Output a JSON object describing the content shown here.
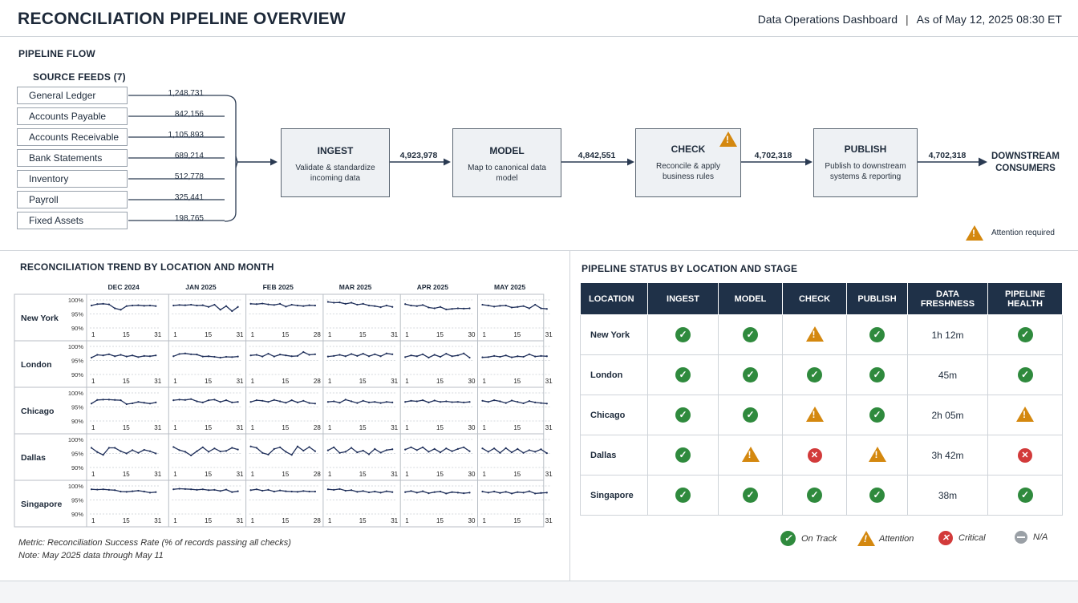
{
  "header": {
    "title": "RECONCILIATION PIPELINE OVERVIEW",
    "dashboard": "Data Operations Dashboard",
    "separator": "|",
    "as_of": "As of May 12, 2025 08:30 ET"
  },
  "flow": {
    "section_title": "PIPELINE FLOW",
    "feeds_title": "SOURCE FEEDS (7)",
    "feeds": [
      {
        "name": "General Ledger",
        "value": "1,248,731"
      },
      {
        "name": "Accounts Payable",
        "value": "842,156"
      },
      {
        "name": "Accounts Receivable",
        "value": "1,105,893"
      },
      {
        "name": "Bank Statements",
        "value": "689,214"
      },
      {
        "name": "Inventory",
        "value": "512,778"
      },
      {
        "name": "Payroll",
        "value": "325,441"
      },
      {
        "name": "Fixed Assets",
        "value": "198,765"
      }
    ],
    "stages": [
      {
        "title": "INGEST",
        "desc1": "Validate & standardize",
        "desc2": "incoming data"
      },
      {
        "title": "MODEL",
        "desc1": "Map to canonical data",
        "desc2": "model"
      },
      {
        "title": "CHECK",
        "desc1": "Reconcile & apply",
        "desc2": "business rules"
      },
      {
        "title": "PUBLISH",
        "desc1": "Publish to downstream",
        "desc2": "systems & reporting"
      }
    ],
    "flow_values": [
      "4,923,978",
      "4,842,551",
      "4,702,318",
      "4,702,318"
    ],
    "downstream1": "DOWNSTREAM",
    "downstream2": "CONSUMERS",
    "attention_label": "Attention required"
  },
  "trend": {
    "section_title": "RECONCILIATION TREND BY LOCATION AND MONTH",
    "months": [
      "DEC 2024",
      "JAN 2025",
      "FEB 2025",
      "MAR 2025",
      "APR 2025",
      "MAY 2025"
    ],
    "month_end": [
      "31",
      "31",
      "28",
      "31",
      "30",
      "31"
    ],
    "locations": [
      "New York",
      "London",
      "Chicago",
      "Dallas",
      "Singapore"
    ],
    "y_ticks": [
      "100%",
      "95%",
      "90%"
    ],
    "x_start": "1",
    "x_mid": "15",
    "note1": "Metric: Reconciliation Success Rate (% of records passing all checks)",
    "note2": "Note: May 2025 data through May 11"
  },
  "chart_data": {
    "type": "line",
    "title": "RECONCILIATION TREND BY LOCATION AND MONTH",
    "ylim": [
      89,
      100
    ],
    "series": [
      {
        "name": "New York",
        "months": [
          [
            98,
            98.5,
            98.6,
            98.4,
            97,
            96.5,
            97.8,
            98,
            98.1,
            97.9,
            98,
            97.8
          ],
          [
            98,
            98.2,
            98.1,
            98.3,
            98,
            98.1,
            97.5,
            98.3,
            96.5,
            97.8,
            96,
            97.5
          ],
          [
            98.6,
            98.5,
            98.7,
            98.4,
            98.2,
            98.6,
            97.6,
            98.3,
            98,
            97.8,
            98.1,
            98
          ],
          [
            99.3,
            99,
            99.1,
            98.6,
            99,
            98.3,
            98.6,
            98,
            97.8,
            97.4,
            98,
            97.5
          ],
          [
            98.5,
            98,
            97.8,
            98.2,
            97.3,
            97,
            97.5,
            96.6,
            96.8,
            97,
            96.9,
            97
          ],
          [
            98.3,
            98,
            97.6,
            97.9,
            98,
            97.3,
            97.5,
            97.8,
            97,
            98.3,
            97,
            96.8
          ]
        ]
      },
      {
        "name": "London",
        "months": [
          [
            96,
            97,
            96.8,
            97.2,
            96.5,
            97,
            96.4,
            96.8,
            96.2,
            96.6,
            96.5,
            96.8
          ],
          [
            96.5,
            97.3,
            97.5,
            97.2,
            97.1,
            96.4,
            96.5,
            96.3,
            96,
            96.3,
            96.2,
            96.4
          ],
          [
            96.8,
            97,
            96.4,
            97.4,
            96.4,
            97.1,
            96.8,
            96.5,
            96.6,
            98,
            97,
            97.2
          ],
          [
            96.4,
            96.6,
            97,
            96.5,
            97.3,
            96.6,
            97.4,
            96.5,
            97.2,
            96.5,
            97.5,
            97.2
          ],
          [
            96.2,
            96.8,
            96.5,
            97.2,
            96,
            97,
            96.3,
            97.4,
            96.5,
            96.8,
            97.5,
            96
          ],
          [
            96.1,
            96.2,
            96.6,
            96.3,
            96.8,
            96.1,
            96.5,
            96.3,
            97.2,
            96.4,
            96.6,
            96.5
          ]
        ]
      },
      {
        "name": "Chicago",
        "months": [
          [
            96.2,
            97.5,
            97.6,
            97.6,
            97.5,
            97.4,
            96,
            96.3,
            96.8,
            96.5,
            96.2,
            96.6
          ],
          [
            97.4,
            97.6,
            97.5,
            97.8,
            97,
            96.6,
            97.4,
            97.6,
            96.8,
            97.4,
            96.6,
            96.8
          ],
          [
            96.8,
            97.4,
            97.2,
            96.8,
            97.5,
            97,
            96.5,
            97.4,
            96.6,
            97.2,
            96.4,
            96.2
          ],
          [
            96.8,
            97,
            96.5,
            97.6,
            97,
            96.4,
            97.2,
            96.6,
            96.8,
            96.4,
            96.8,
            96.6
          ],
          [
            96.8,
            97.2,
            97,
            97.4,
            96.6,
            97.3,
            96.8,
            97,
            96.7,
            96.8,
            96.6,
            96.8
          ],
          [
            97.2,
            96.8,
            97.4,
            97,
            96.4,
            97.3,
            96.8,
            96.3,
            97.1,
            96.6,
            96.4,
            96.2
          ]
        ]
      },
      {
        "name": "Dallas",
        "months": [
          [
            97,
            95.5,
            94.5,
            97,
            97,
            95.8,
            95,
            96.2,
            95.2,
            96.3,
            95.8,
            95
          ],
          [
            97.3,
            96.2,
            95.6,
            94.3,
            95.8,
            97.2,
            95.6,
            96.8,
            95.7,
            95.9,
            97,
            96.4
          ],
          [
            97.5,
            97,
            95.2,
            94.6,
            96.6,
            97.2,
            95.6,
            94.5,
            97.5,
            96,
            97.3,
            95.8
          ],
          [
            96.1,
            97.2,
            95.2,
            95.6,
            97,
            95.4,
            96,
            94.7,
            96.6,
            95.3,
            96.2,
            96.5
          ],
          [
            96.4,
            97.2,
            96.2,
            97.2,
            95.6,
            96.6,
            95.4,
            96.8,
            95.8,
            96.6,
            97.2,
            95.8
          ],
          [
            96.8,
            95.6,
            96.8,
            95.2,
            96.9,
            95.4,
            96.6,
            95.2,
            96.2,
            95.6,
            96.5,
            95.1
          ]
        ]
      },
      {
        "name": "Singapore",
        "months": [
          [
            98.8,
            98.7,
            98.8,
            98.6,
            98.5,
            98,
            97.9,
            98.1,
            98.3,
            98,
            97.6,
            97.8
          ],
          [
            98.8,
            99,
            98.9,
            98.8,
            98.6,
            98.8,
            98.5,
            98.6,
            98.2,
            98.7,
            97.8,
            98.1
          ],
          [
            98.5,
            98.8,
            98.3,
            98.6,
            98,
            98.4,
            98.1,
            98,
            97.9,
            98.2,
            98,
            98
          ],
          [
            98.8,
            98.6,
            98.9,
            98.3,
            98.5,
            97.9,
            98.2,
            97.7,
            98,
            97.6,
            98.1,
            97.8
          ],
          [
            97.8,
            98.2,
            97.6,
            98.1,
            97.4,
            97.8,
            98,
            97.3,
            97.8,
            97.6,
            97.4,
            97.6
          ],
          [
            98,
            97.6,
            98,
            97.5,
            97.9,
            97.3,
            97.8,
            97.6,
            98.1,
            97.3,
            97.5,
            97.6
          ]
        ]
      }
    ]
  },
  "status": {
    "section_title": "PIPELINE STATUS BY LOCATION AND STAGE",
    "headers": {
      "location": "LOCATION",
      "ingest": "INGEST",
      "model": "MODEL",
      "check": "CHECK",
      "publish": "PUBLISH",
      "fresh1": "DATA",
      "fresh2": "FRESHNESS",
      "health1": "PIPELINE",
      "health2": "HEALTH"
    },
    "rows": [
      {
        "location": "New York",
        "ingest": "ok",
        "model": "ok",
        "check": "attention",
        "publish": "ok",
        "freshness": "1h 12m",
        "health": "ok"
      },
      {
        "location": "London",
        "ingest": "ok",
        "model": "ok",
        "check": "ok",
        "publish": "ok",
        "freshness": "45m",
        "health": "ok"
      },
      {
        "location": "Chicago",
        "ingest": "ok",
        "model": "ok",
        "check": "attention",
        "publish": "ok",
        "freshness": "2h 05m",
        "health": "attention"
      },
      {
        "location": "Dallas",
        "ingest": "ok",
        "model": "attention",
        "check": "critical",
        "publish": "attention",
        "freshness": "3h 42m",
        "health": "critical"
      },
      {
        "location": "Singapore",
        "ingest": "ok",
        "model": "ok",
        "check": "ok",
        "publish": "ok",
        "freshness": "38m",
        "health": "ok"
      }
    ],
    "legend": {
      "ok": "On Track",
      "attention": "Attention",
      "critical": "Critical",
      "na": "N/A"
    }
  },
  "colors": {
    "navy": "#1f3148",
    "ok": "#2f8a3d",
    "attention": "#d4880f",
    "critical": "#d23a3a",
    "line": "#1f2f5a"
  }
}
